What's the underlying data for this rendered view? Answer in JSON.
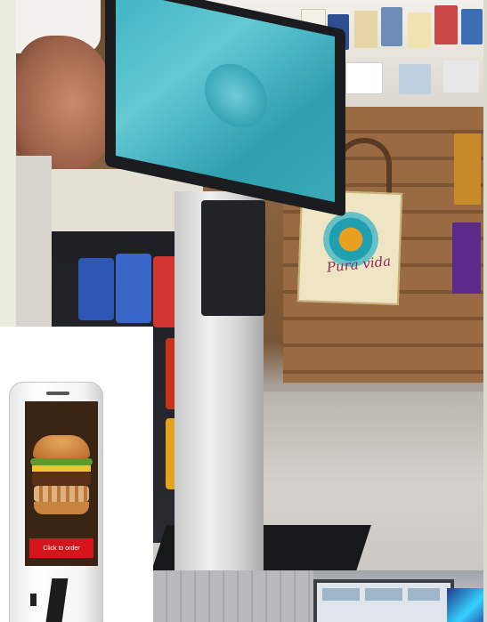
{
  "image": {
    "description_items": {
      "main_photo": "store-kiosk-photo",
      "inset_left": "white-food-kiosk",
      "inset_bottom": "warehouse-photo"
    }
  },
  "main_photo": {
    "tote_bag_text": "Pura vida"
  },
  "inset_kiosk": {
    "button_text": "Click to order"
  },
  "colors": {
    "screen_teal": "#3fb3c2",
    "kiosk_red": "#d4161c",
    "tote_text": "#8a2b5a"
  }
}
